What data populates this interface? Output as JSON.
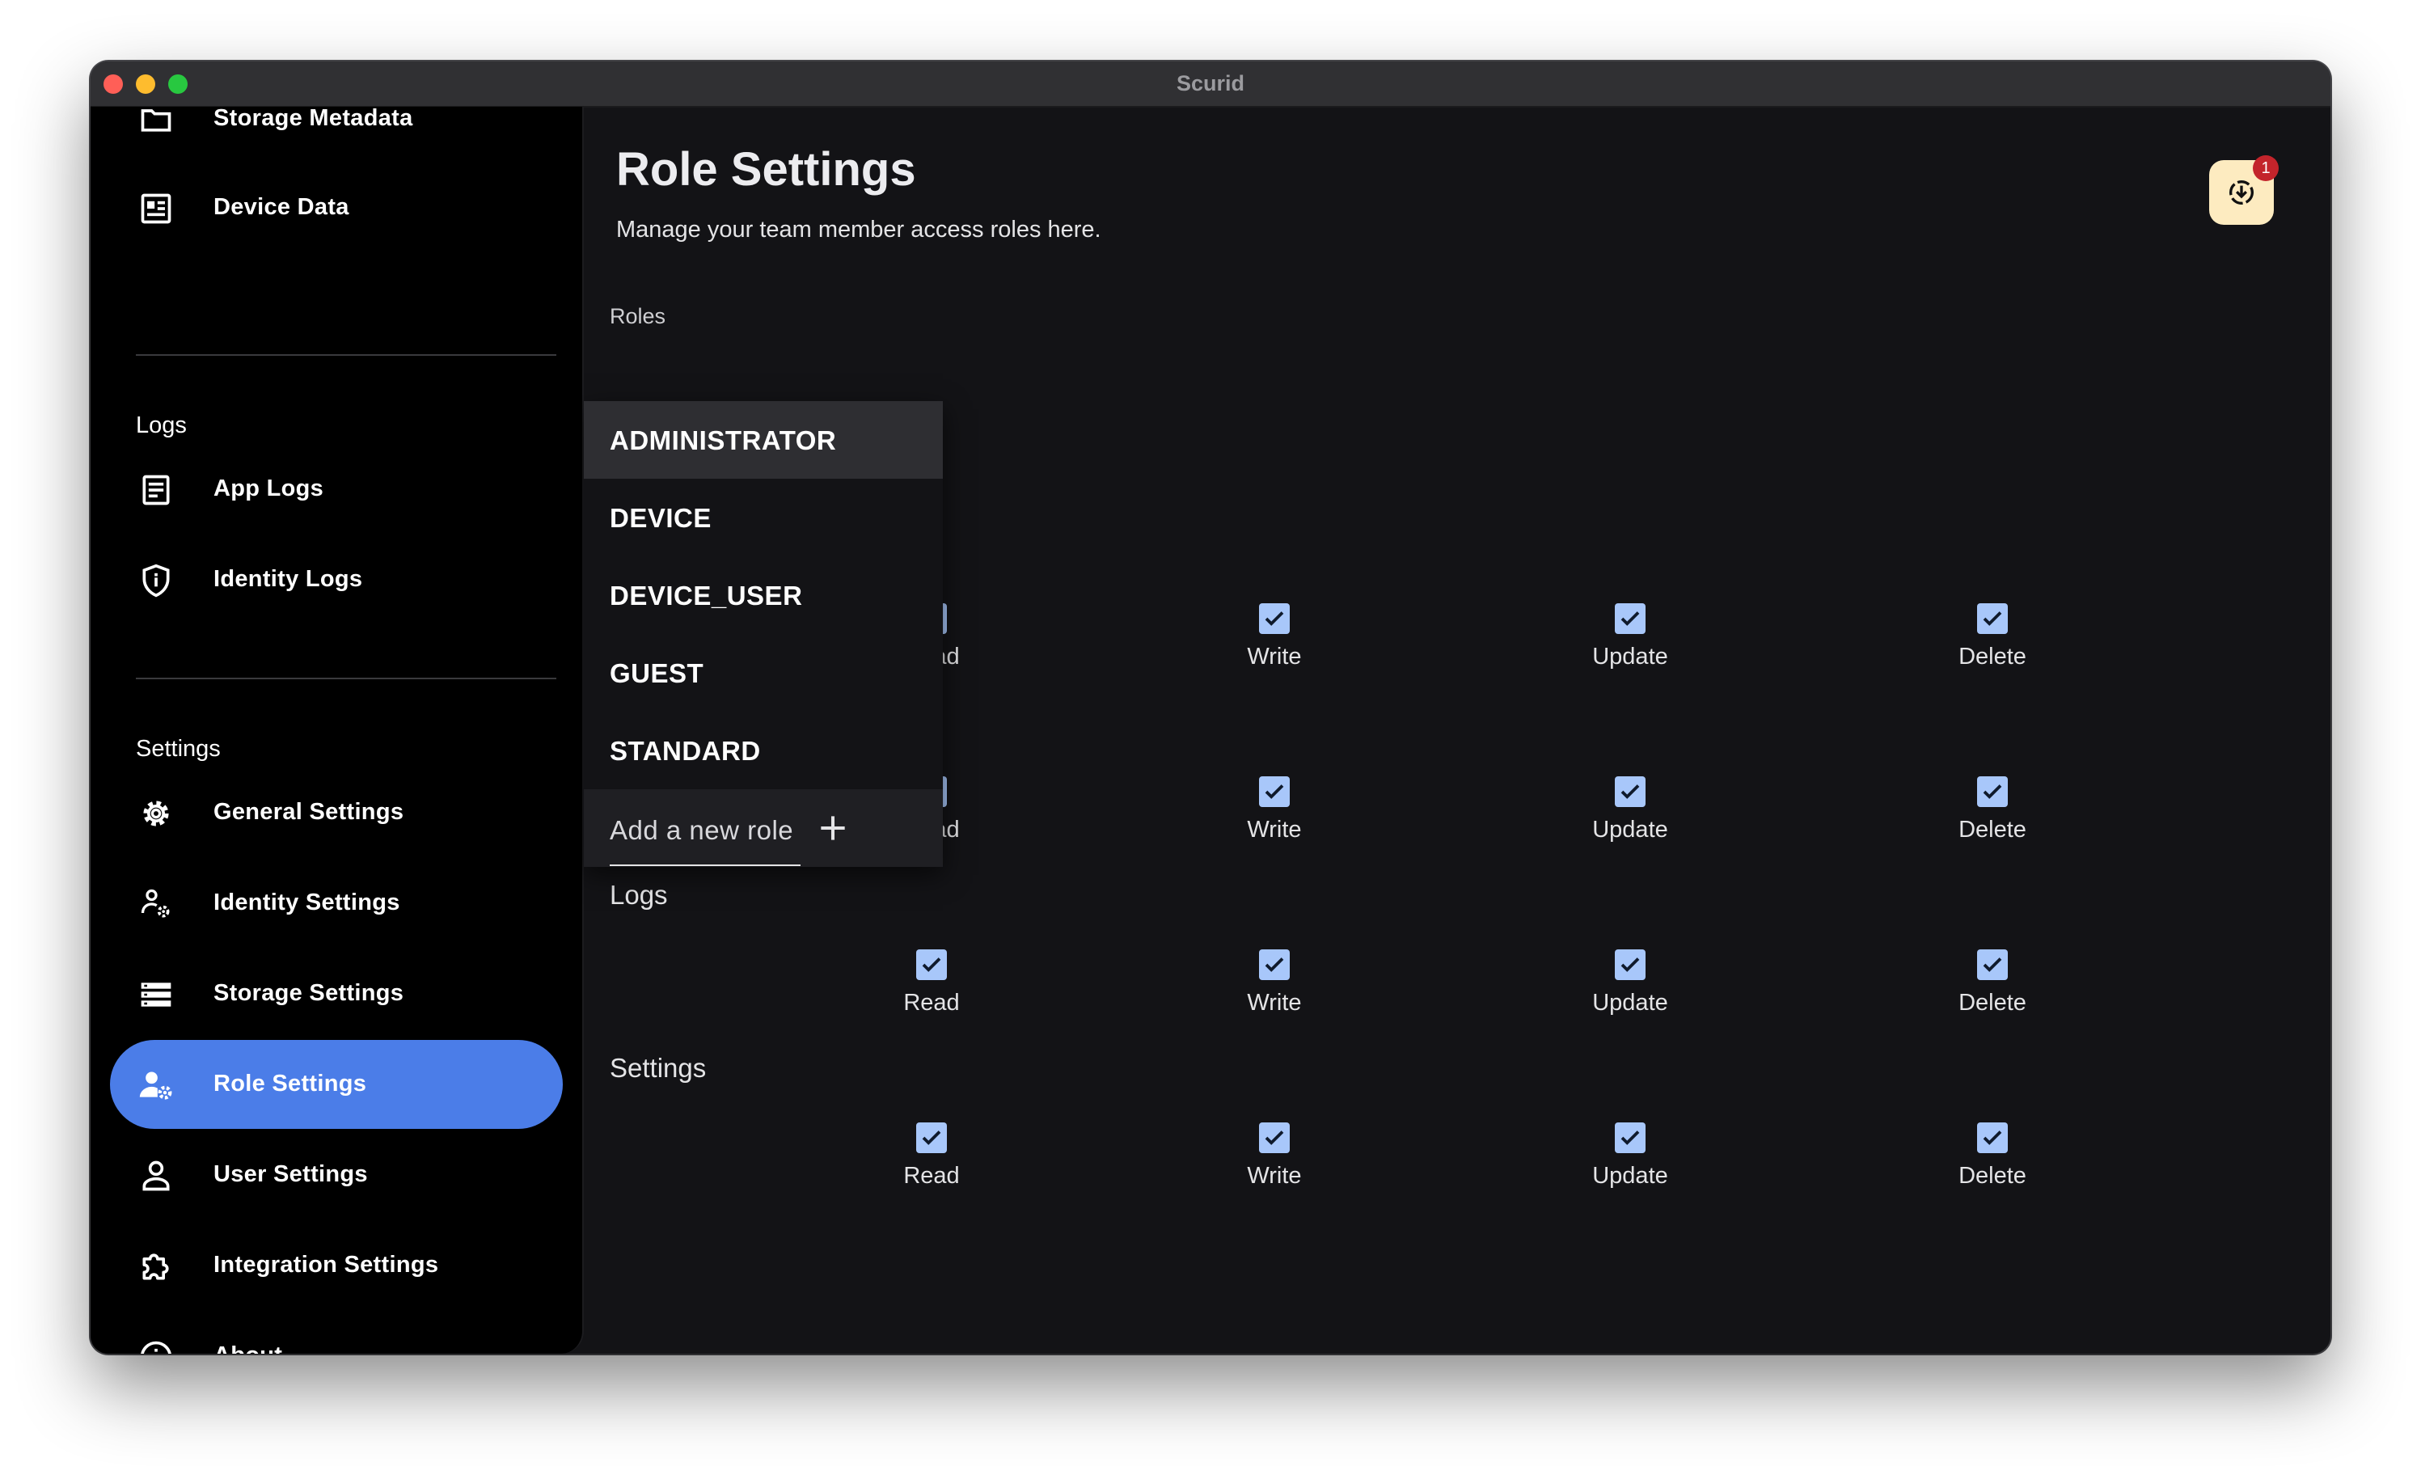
{
  "window": {
    "title": "Scurid"
  },
  "sidebar": {
    "top_items": [
      {
        "label": "Storage Metadata",
        "icon": "folder-icon"
      },
      {
        "label": "Device Data",
        "icon": "device-data-icon"
      }
    ],
    "logs_section": {
      "label": "Logs",
      "items": [
        {
          "label": "App Logs",
          "icon": "document-icon"
        },
        {
          "label": "Identity Logs",
          "icon": "shield-icon"
        }
      ]
    },
    "settings_section": {
      "label": "Settings",
      "items": [
        {
          "label": "General Settings",
          "icon": "gear-icon"
        },
        {
          "label": "Identity Settings",
          "icon": "identity-settings-icon"
        },
        {
          "label": "Storage Settings",
          "icon": "storage-icon"
        },
        {
          "label": "Role Settings",
          "icon": "person-gear-icon",
          "active": true
        },
        {
          "label": "User Settings",
          "icon": "person-icon"
        },
        {
          "label": "Integration Settings",
          "icon": "puzzle-icon"
        },
        {
          "label": "About",
          "icon": "info-icon"
        }
      ]
    }
  },
  "main": {
    "title": "Role Settings",
    "subtitle": "Manage your team member access roles here.",
    "roles_label": "Roles",
    "notifications": {
      "count": "1",
      "icon": "download-icon"
    },
    "permission_groups": [
      {
        "name": "",
        "permissions": [
          {
            "label": "Read",
            "checked": true
          },
          {
            "label": "Write",
            "checked": true
          },
          {
            "label": "Update",
            "checked": true
          },
          {
            "label": "Delete",
            "checked": true
          }
        ]
      },
      {
        "name": "",
        "permissions": [
          {
            "label": "Read",
            "checked": true
          },
          {
            "label": "Write",
            "checked": true
          },
          {
            "label": "Update",
            "checked": true
          },
          {
            "label": "Delete",
            "checked": true
          }
        ]
      },
      {
        "name": "Logs",
        "permissions": [
          {
            "label": "Read",
            "checked": true
          },
          {
            "label": "Write",
            "checked": true
          },
          {
            "label": "Update",
            "checked": true
          },
          {
            "label": "Delete",
            "checked": true
          }
        ]
      },
      {
        "name": "Settings",
        "permissions": [
          {
            "label": "Read",
            "checked": true
          },
          {
            "label": "Write",
            "checked": true
          },
          {
            "label": "Update",
            "checked": true
          },
          {
            "label": "Delete",
            "checked": true
          }
        ]
      }
    ]
  },
  "roles_dropdown": {
    "options": [
      "ADMINISTRATOR",
      "DEVICE",
      "DEVICE_USER",
      "GUEST",
      "STANDARD"
    ],
    "selected": "ADMINISTRATOR",
    "add_label": "Add a new role"
  },
  "colors": {
    "accent": "#4b7de8",
    "checkbox": "#a8c7fa",
    "background": "#131316",
    "sidebar": "#000000",
    "badge": "#c3242b",
    "notification_button": "#fdebc0"
  }
}
